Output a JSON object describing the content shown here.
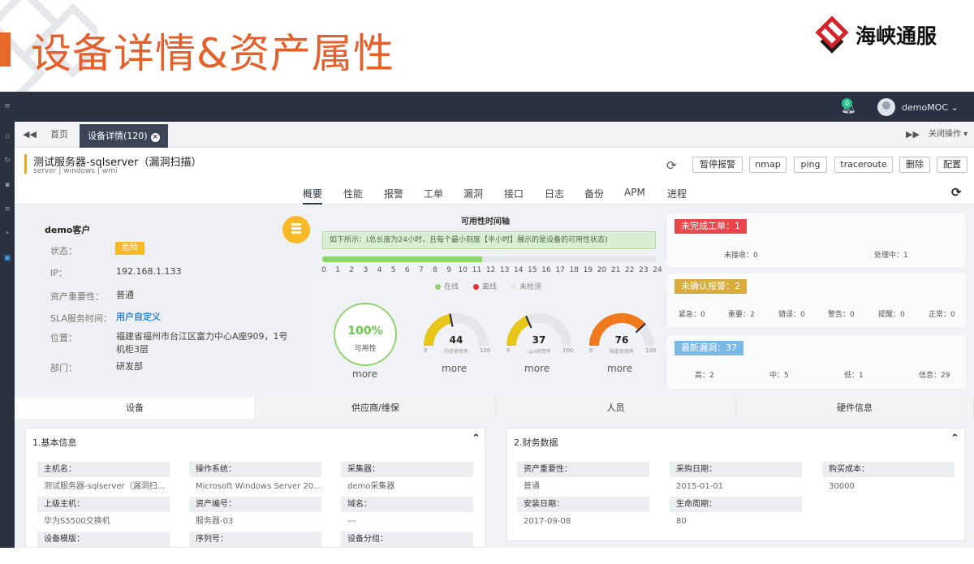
{
  "slide": {
    "title": "设备详情&资产属性",
    "brand_name": "海峡通服"
  },
  "topbar": {
    "notification_count": "0",
    "user_name": "demoMOC ⌄"
  },
  "tabs": {
    "home": "首页",
    "active": "设备详情(120)",
    "close_ops": "关闭操作 ▾"
  },
  "device": {
    "title": "测试服务器-sqlserver（漏洞扫描）",
    "tags": "server | windows | wmi",
    "actions": [
      "暂停报警",
      "nmap",
      "ping",
      "traceroute",
      "删除",
      "配置"
    ]
  },
  "nav": [
    "概要",
    "性能",
    "报警",
    "工单",
    "漏洞",
    "接口",
    "日志",
    "备份",
    "APM",
    "进程"
  ],
  "customer": {
    "title": "demo客户",
    "status_label": "状态：",
    "status_value": "危险",
    "ip_label": "IP：",
    "ip_value": "192.168.1.133",
    "importance_label": "资产重要性：",
    "importance_value": "普通",
    "sla_label": "SLA服务时间：",
    "sla_value": "用户自定义",
    "location_label": "位置：",
    "location_value": "福建省福州市台江区富力中心A座909，1号机柜3层",
    "dept_label": "部门：",
    "dept_value": "研发部"
  },
  "availability": {
    "title": "可用性时间轴",
    "note": "如下所示：(总长度为24小时，且每个最小刻度【半小时】展示的是设备的可用性状态)",
    "online_fraction": 0.48,
    "ticks": [
      "0",
      "1",
      "2",
      "3",
      "4",
      "5",
      "6",
      "7",
      "8",
      "9",
      "10",
      "11",
      "12",
      "13",
      "14",
      "15",
      "16",
      "17",
      "18",
      "19",
      "20",
      "21",
      "22",
      "23",
      "24"
    ],
    "legend": [
      "在线",
      "离线",
      "未检测"
    ]
  },
  "gauges": {
    "availability": {
      "value": "100%",
      "label": "可用性",
      "fraction": 1.0
    },
    "items": [
      {
        "value": "44",
        "label": "内存使用率",
        "min": "0",
        "max": "100",
        "fraction": 0.44,
        "color": "#e6c619"
      },
      {
        "value": "37",
        "label": "cpu使用率",
        "min": "0",
        "max": "100",
        "fraction": 0.37,
        "color": "#e6c619"
      },
      {
        "value": "76",
        "label": "磁盘使用率",
        "min": "0",
        "max": "100",
        "fraction": 0.76,
        "color": "#f07a1b"
      }
    ],
    "more": "more"
  },
  "workorder": {
    "tag": "未完成工单：1",
    "stats": [
      "未接收：0",
      "处理中：1"
    ]
  },
  "alarms": {
    "tag": "未确认报警：2",
    "stats": [
      "紧急：0",
      "重要：2",
      "错误：0",
      "警告：0",
      "提醒：0",
      "正常：0"
    ]
  },
  "vulns": {
    "tag": "最新漏洞：37",
    "stats": [
      "高：2",
      "中：5",
      "低：1",
      "信息：29"
    ]
  },
  "bottom_tabs": [
    "设备",
    "供应商/维保",
    "人员",
    "硬件信息"
  ],
  "basic_info": {
    "title": "1.基本信息",
    "fields": [
      {
        "label": "主机名：",
        "value": "测试服务器-sqlserver（漏洞扫..."
      },
      {
        "label": "操作系统：",
        "value": "Microsoft Windows Server 20..."
      },
      {
        "label": "采集器：",
        "value": "demo采集器"
      },
      {
        "label": "上级主机：",
        "value": "华为S5500交换机"
      },
      {
        "label": "资产编号：",
        "value": "服务器-03"
      },
      {
        "label": "域名：",
        "value": "---"
      },
      {
        "label": "设备模版：",
        "value": ""
      },
      {
        "label": "序列号：",
        "value": ""
      },
      {
        "label": "设备分组：",
        "value": ""
      }
    ]
  },
  "finance": {
    "title": "2.财务数据",
    "fields": [
      {
        "label": "资产重要性：",
        "value": "普通"
      },
      {
        "label": "采购日期：",
        "value": "2015-01-01"
      },
      {
        "label": "购买成本：",
        "value": "30000"
      },
      {
        "label": "安装日期：",
        "value": "2017-09-08"
      },
      {
        "label": "生命周期：",
        "value": "80"
      }
    ]
  },
  "colors": {
    "accent": "#e5602b",
    "warning": "#f7b928",
    "alarm_red": "#e8474c",
    "alarm_gold": "#d9aa3c",
    "vuln_blue": "#7ab8e8",
    "online": "#8fd46d",
    "offline": "#e03030",
    "unchecked": "#e8e8e8"
  }
}
